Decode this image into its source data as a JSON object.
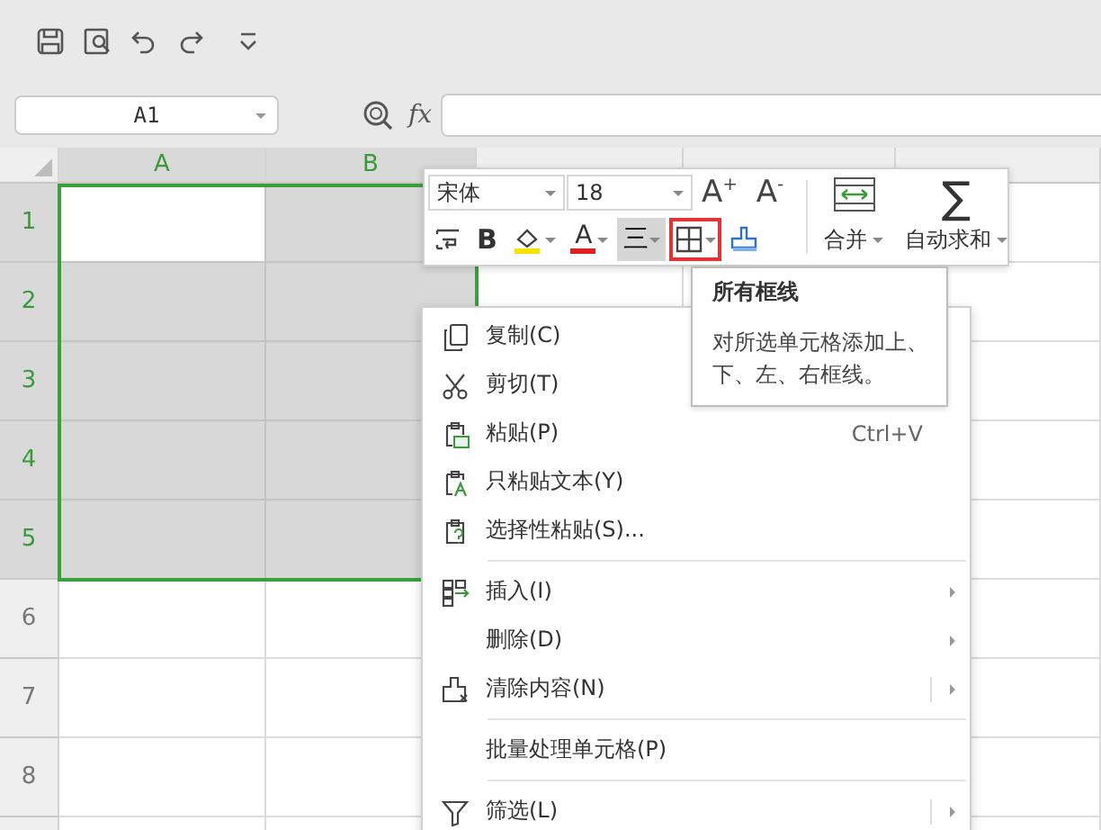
{
  "formula_bar": {
    "name_box": "A1",
    "fx": "fx"
  },
  "grid": {
    "columns": [
      {
        "label": "A",
        "selected": true
      },
      {
        "label": "B",
        "selected": true
      },
      {
        "selected": false
      },
      {
        "selected": false
      },
      {
        "selected": false
      }
    ],
    "rows": [
      {
        "label": "1",
        "selected": true
      },
      {
        "label": "2",
        "selected": true
      },
      {
        "label": "3",
        "selected": true
      },
      {
        "label": "4",
        "selected": true
      },
      {
        "label": "5",
        "selected": true
      },
      {
        "label": "6",
        "selected": false
      },
      {
        "label": "7",
        "selected": false
      },
      {
        "label": "8",
        "selected": false
      }
    ]
  },
  "mini_toolbar": {
    "font": "宋体",
    "size": "18",
    "size_buttons": [
      {
        "label": "A$^{+}$"
      },
      {
        "label": "A$^{-}$"
      }
    ],
    "tools": [
      {
        "kind": "wrap",
        "selected": false,
        "highlighted": false
      },
      {
        "kind": "bold",
        "label": "B",
        "selected": false,
        "highlighted": false
      },
      {
        "kind": "fill",
        "selected": false,
        "highlighted": false
      },
      {
        "kind": "font-color",
        "label": "A",
        "selected": false,
        "highlighted": false
      },
      {
        "kind": "align",
        "label": "三",
        "selected": true,
        "highlighted": false
      },
      {
        "kind": "borders",
        "selected": false,
        "highlighted": true
      },
      {
        "kind": "painter",
        "selected": false,
        "highlighted": false
      }
    ],
    "merge": "合并",
    "autosum": {
      "symbol": "∑",
      "label": "自动求和"
    }
  },
  "tooltip": {
    "title": "所有框线",
    "text": "对所选单元格添加上、下、左、右框线。"
  },
  "context_menu": [
    {
      "kind": "copy",
      "label": "复制(C)"
    },
    {
      "kind": "cut",
      "label": "剪切(T)"
    },
    {
      "kind": "paste",
      "label": "粘贴(P)",
      "shortcut": "Ctrl+V"
    },
    {
      "kind": "paste-text",
      "label": "只粘贴文本(Y)"
    },
    {
      "kind": "paste-special",
      "label": "选择性粘贴(S)..."
    },
    {
      "kind": "separator"
    },
    {
      "kind": "insert",
      "label": "插入(I)",
      "submenu": true,
      "split": false
    },
    {
      "kind": "plain",
      "label": "删除(D)",
      "submenu": true,
      "split": false
    },
    {
      "kind": "clear",
      "label": "清除内容(N)",
      "submenu": true,
      "split": true
    },
    {
      "kind": "separator"
    },
    {
      "kind": "plain",
      "label": "批量处理单元格(P)"
    },
    {
      "kind": "separator"
    },
    {
      "kind": "filter",
      "label": "筛选(L)",
      "submenu": true,
      "split": true
    }
  ]
}
